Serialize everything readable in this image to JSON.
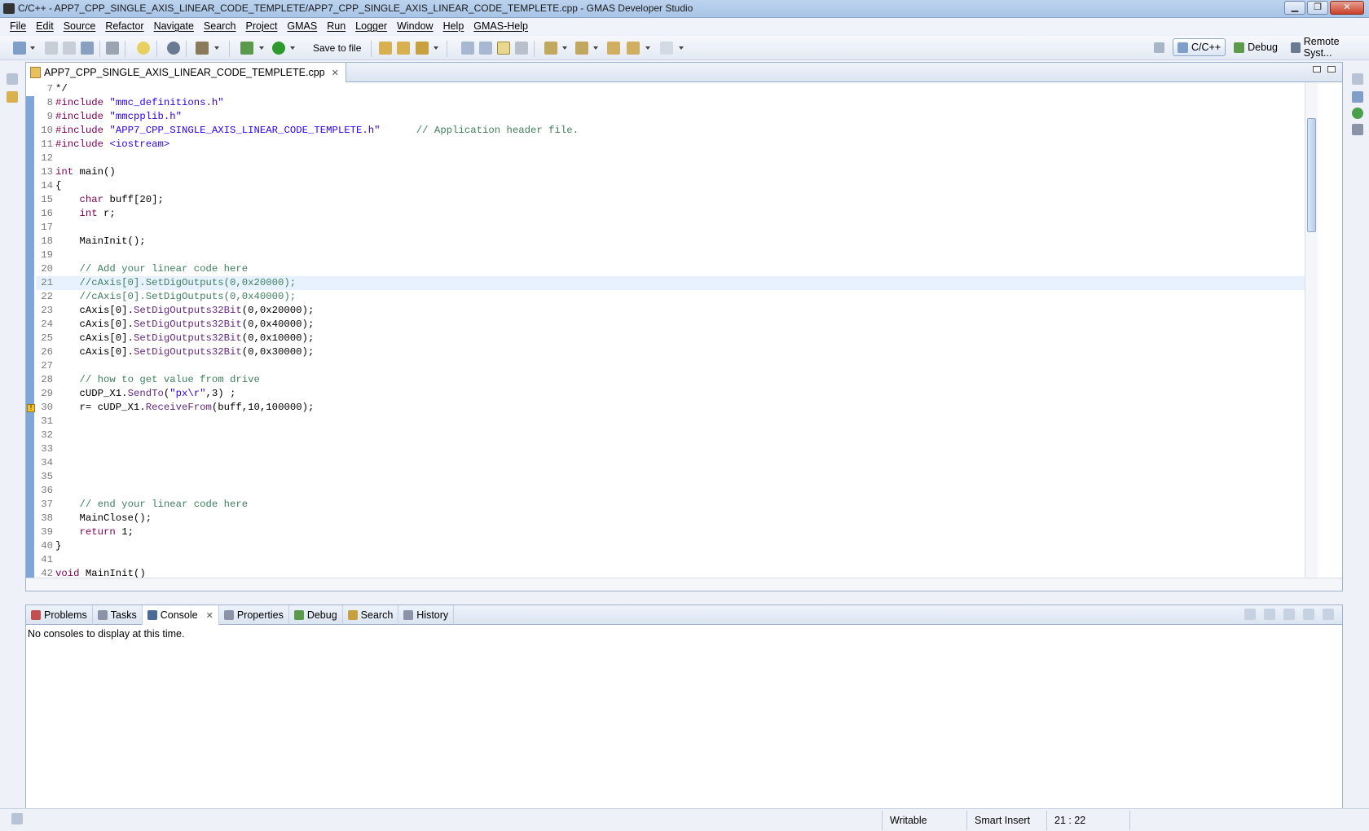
{
  "window": {
    "title": "C/C++ - APP7_CPP_SINGLE_AXIS_LINEAR_CODE_TEMPLETE/APP7_CPP_SINGLE_AXIS_LINEAR_CODE_TEMPLETE.cpp - GMAS Developer Studio"
  },
  "menu": [
    "File",
    "Edit",
    "Source",
    "Refactor",
    "Navigate",
    "Search",
    "Project",
    "GMAS",
    "Run",
    "Logger",
    "Window",
    "Help",
    "GMAS-Help"
  ],
  "toolbar": {
    "save_to_file": "Save to file"
  },
  "perspectives": {
    "cpp": "C/C++",
    "debug": "Debug",
    "remote": "Remote Syst..."
  },
  "editor": {
    "tab_label": "APP7_CPP_SINGLE_AXIS_LINEAR_CODE_TEMPLETE.cpp",
    "lines": [
      {
        "n": "7",
        "t": "*/"
      },
      {
        "n": "8",
        "t": "#include \"mmc_definitions.h\""
      },
      {
        "n": "9",
        "t": "#include \"mmcpplib.h\""
      },
      {
        "n": "10",
        "t": "#include \"APP7_CPP_SINGLE_AXIS_LINEAR_CODE_TEMPLETE.h\"      // Application header file."
      },
      {
        "n": "11",
        "t": "#include <iostream>"
      },
      {
        "n": "12",
        "t": ""
      },
      {
        "n": "13",
        "t": "int main()"
      },
      {
        "n": "14",
        "t": "{"
      },
      {
        "n": "15",
        "t": "    char buff[20];"
      },
      {
        "n": "16",
        "t": "    int r;"
      },
      {
        "n": "17",
        "t": ""
      },
      {
        "n": "18",
        "t": "    MainInit();"
      },
      {
        "n": "19",
        "t": ""
      },
      {
        "n": "20",
        "t": "    // Add your linear code here"
      },
      {
        "n": "21",
        "t": "    //cAxis[0].SetDigOutputs(0,0x20000);"
      },
      {
        "n": "22",
        "t": "    //cAxis[0].SetDigOutputs(0,0x40000);"
      },
      {
        "n": "23",
        "t": "    cAxis[0].SetDigOutputs32Bit(0,0x20000);"
      },
      {
        "n": "24",
        "t": "    cAxis[0].SetDigOutputs32Bit(0,0x40000);"
      },
      {
        "n": "25",
        "t": "    cAxis[0].SetDigOutputs32Bit(0,0x10000);"
      },
      {
        "n": "26",
        "t": "    cAxis[0].SetDigOutputs32Bit(0,0x30000);"
      },
      {
        "n": "27",
        "t": ""
      },
      {
        "n": "28",
        "t": "    // how to get value from drive"
      },
      {
        "n": "29",
        "t": "    cUDP_X1.SendTo(\"px\\r\",3) ;"
      },
      {
        "n": "30",
        "t": "    r= cUDP_X1.ReceiveFrom(buff,10,100000);"
      },
      {
        "n": "31",
        "t": ""
      },
      {
        "n": "32",
        "t": ""
      },
      {
        "n": "33",
        "t": ""
      },
      {
        "n": "34",
        "t": ""
      },
      {
        "n": "35",
        "t": ""
      },
      {
        "n": "36",
        "t": ""
      },
      {
        "n": "37",
        "t": "    // end your linear code here"
      },
      {
        "n": "38",
        "t": "    MainClose();"
      },
      {
        "n": "39",
        "t": "    return 1;"
      },
      {
        "n": "40",
        "t": "}"
      },
      {
        "n": "41",
        "t": ""
      },
      {
        "n": "42",
        "t": "void MainInit()"
      }
    ]
  },
  "console": {
    "tabs": [
      "Problems",
      "Tasks",
      "Console",
      "Properties",
      "Debug",
      "Search",
      "History"
    ],
    "message": "No consoles to display at this time."
  },
  "status": {
    "writable": "Writable",
    "insert_mode": "Smart Insert",
    "position": "21 : 22"
  }
}
